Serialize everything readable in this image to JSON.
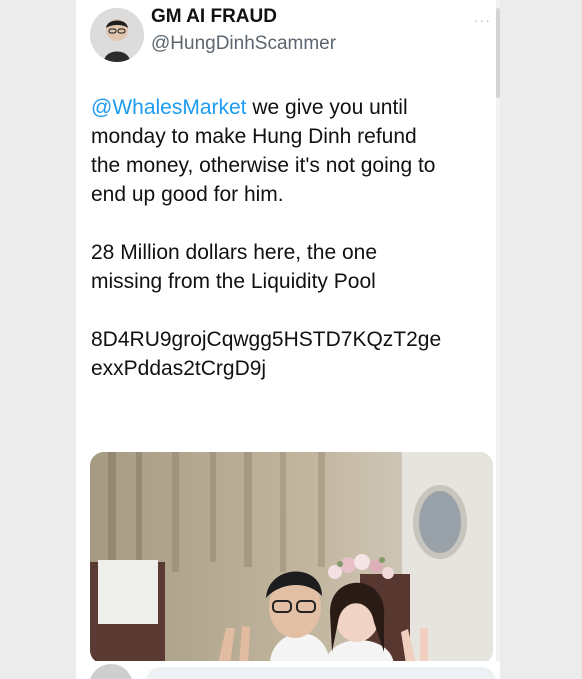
{
  "user": {
    "display_name": "GM AI FRAUD",
    "handle": "@HungDinhScammer"
  },
  "menu": {
    "more_icon": "more-dots-icon",
    "glyph": "···"
  },
  "tweet": {
    "mention": "@WhalesMarket",
    "line1_after_mention": " we give you until",
    "line2": "monday to make Hung Dinh refund",
    "line3": "the money, otherwise it's not going to",
    "line4": "end up good for him.",
    "line5": "28 Million dollars here, the one",
    "line6": "missing from the Liquidity Pool",
    "line7": "8D4RU9grojCqwgg5HSTD7KQzT2ge",
    "line8": "exxPddas2tCrgD9j"
  },
  "colors": {
    "mention": "#1d9bf0",
    "text": "#111111",
    "handle": "#5b6670"
  }
}
